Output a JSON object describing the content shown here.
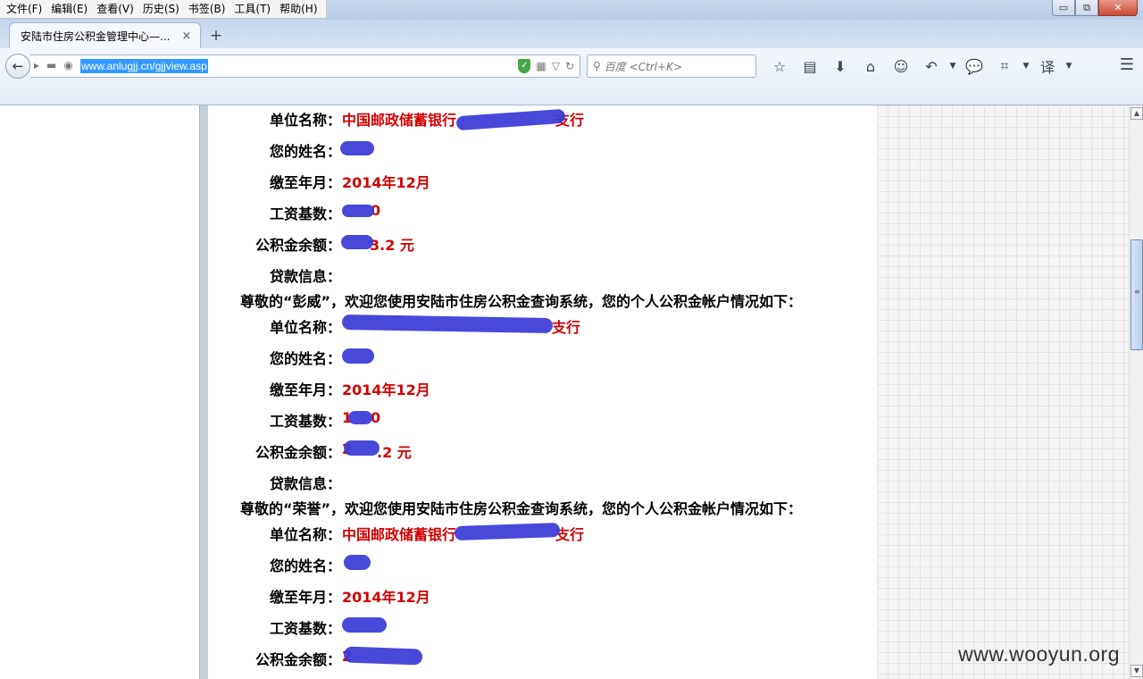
{
  "menu": [
    "文件(F)",
    "编辑(E)",
    "查看(V)",
    "历史(S)",
    "书签(B)",
    "工具(T)",
    "帮助(H)"
  ],
  "window_controls": {
    "minimize": "▭",
    "restore": "⧉",
    "close": "✕"
  },
  "tab": {
    "title": "安陆市住房公积金管理中心—...",
    "close": "×",
    "new_tab": "+"
  },
  "address": {
    "url": "www.anlugjj.cn/gjjview.asp"
  },
  "search": {
    "placeholder": "百度 <Ctrl+K>"
  },
  "page": {
    "labels": {
      "unit": "单位名称：",
      "name": "您的姓名：",
      "paid_until": "缴至年月：",
      "salary_base": "工资基数：",
      "balance": "公积金余额：",
      "loan": "贷款信息："
    },
    "record1": {
      "unit": "中国邮政储蓄银行",
      "unit_suffix": "支行",
      "paid_until": "2014年12月",
      "salary_base_suffix": "0",
      "balance_suffix": "3.2 元"
    },
    "record2": {
      "greeting": "尊敬的“彭威”，欢迎您使用安陆市住房公积金查询系统，您的个人公积金帐户情况如下：",
      "unit_suffix": "支行",
      "paid_until": "2014年12月",
      "salary_base": "1",
      "salary_base_suffix": "0",
      "balance": "2",
      "balance_suffix": ".2 元"
    },
    "record3": {
      "greeting": "尊敬的“荣誉”，欢迎您使用安陆市住房公积金查询系统，您的个人公积金帐户情况如下：",
      "unit": "中国邮政储蓄银行",
      "unit_suffix": "支行",
      "paid_until": "2014年12月",
      "balance": "2"
    }
  },
  "watermark": "www.wooyun.org",
  "colors": {
    "value_red": "#d40000",
    "redaction_blue": "#3a3ad6"
  }
}
